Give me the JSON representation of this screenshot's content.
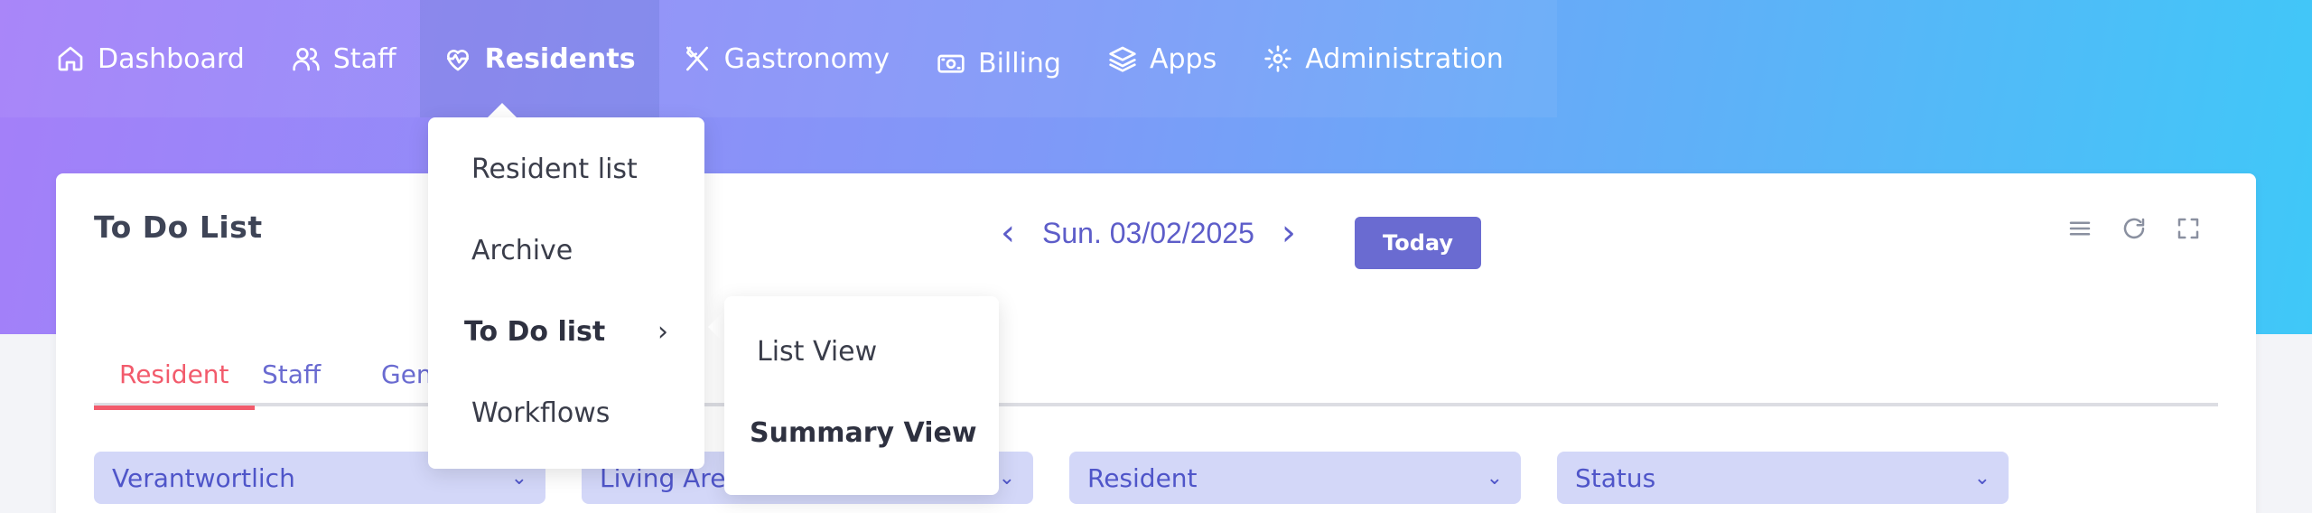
{
  "nav": {
    "items": [
      {
        "label": "Dashboard",
        "icon": "home-icon"
      },
      {
        "label": "Staff",
        "icon": "users-icon"
      },
      {
        "label": "Residents",
        "icon": "heart-pulse-icon"
      },
      {
        "label": "Gastronomy",
        "icon": "utensils-icon"
      },
      {
        "label": "Billing",
        "icon": "banknote-icon"
      },
      {
        "label": "Apps",
        "icon": "layers-icon"
      },
      {
        "label": "Administration",
        "icon": "gear-icon"
      }
    ],
    "active": "Residents"
  },
  "residents_menu": {
    "items": [
      "Resident list",
      "Archive",
      "To Do list",
      "Workflows"
    ],
    "submenu": [
      "List View",
      "Summary View"
    ]
  },
  "card": {
    "title": "To Do List",
    "date": "Sun. 03/02/2025",
    "today_label": "Today",
    "tools": [
      "list-icon",
      "refresh-icon",
      "fullscreen-icon"
    ]
  },
  "tabs": [
    "Resident",
    "Staff",
    "Gen"
  ],
  "filters": [
    "Verantwortlich",
    "Living Area",
    "Resident",
    "Status"
  ],
  "colors": {
    "accent": "#6a6bd1",
    "active_tab": "#f25b6c",
    "filter_bg": "#d3d7f8"
  }
}
